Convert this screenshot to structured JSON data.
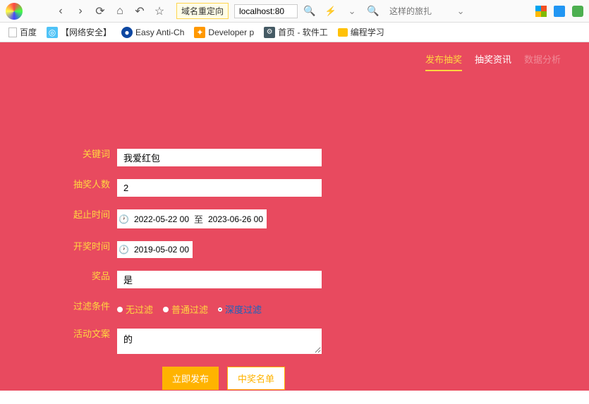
{
  "browser": {
    "addr_badge": "域名重定向",
    "addr_value": "localhost:80",
    "search_placeholder": "这样的旅扎"
  },
  "bookmarks": [
    {
      "label": "百度"
    },
    {
      "label": "【网络安全】"
    },
    {
      "label": "Easy Anti-Ch"
    },
    {
      "label": "Developer p"
    },
    {
      "label": "首页 - 软件工"
    },
    {
      "label": "编程学习"
    }
  ],
  "nav": {
    "items": [
      "发布抽奖",
      "抽奖资讯",
      "数据分析"
    ]
  },
  "form": {
    "keyword": {
      "label": "关键词",
      "value": "我爱红包"
    },
    "count": {
      "label": "抽奖人数",
      "value": "2"
    },
    "range": {
      "label": "起止时间",
      "from": "2022-05-22 00",
      "sep": "至",
      "to": "2023-06-26 00"
    },
    "reveal": {
      "label": "开奖时间",
      "value": "2019-05-02 00"
    },
    "prize": {
      "label": "奖品",
      "value": "是"
    },
    "filter": {
      "label": "过滤条件",
      "options": [
        "无过滤",
        "普通过滤",
        "深度过滤"
      ]
    },
    "copy": {
      "label": "活动文案",
      "value": "的"
    },
    "submit": "立即发布",
    "winners": "中奖名单"
  }
}
